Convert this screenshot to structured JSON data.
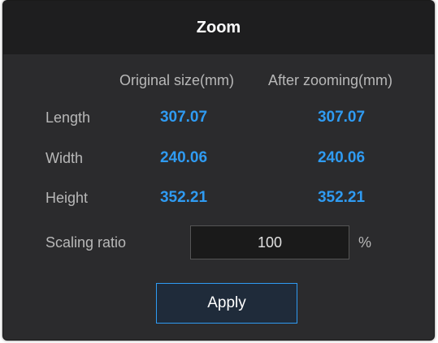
{
  "dialog": {
    "title": "Zoom"
  },
  "columns": {
    "original_header": "Original size(mm)",
    "after_header": "After zooming(mm)"
  },
  "rows": [
    {
      "label": "Length",
      "original": "307.07",
      "after": "307.07"
    },
    {
      "label": "Width",
      "original": "240.06",
      "after": "240.06"
    },
    {
      "label": "Height",
      "original": "352.21",
      "after": "352.21"
    }
  ],
  "scaling": {
    "label": "Scaling ratio",
    "value": "100",
    "unit": "%"
  },
  "actions": {
    "apply_label": "Apply"
  },
  "colors": {
    "accent": "#2f9bf2",
    "background": "#2b2b2d",
    "titlebar": "#1e1e1f"
  }
}
